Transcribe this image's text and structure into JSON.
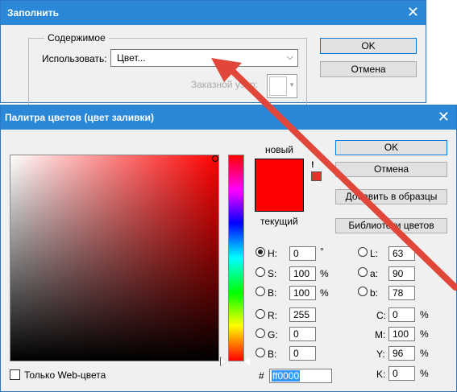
{
  "fill_dialog": {
    "title": "Заполнить",
    "close_icon": "close-icon",
    "group_label": "Содержимое",
    "use_label": "Использовать:",
    "use_value": "Цвет...",
    "custom_label": "Заказной узор:",
    "ok_label": "OK",
    "cancel_label": "Отмена"
  },
  "picker": {
    "title": "Палитра цветов (цвет заливки)",
    "close_icon": "close-icon",
    "new_label": "новый",
    "current_label": "текущий",
    "new_color": "#ff0000",
    "current_color": "#ff0000",
    "buttons": {
      "ok": "OK",
      "cancel": "Отмена",
      "add_to_swatches": "Добавить в образцы",
      "color_libraries": "Библиотеки цветов"
    },
    "hsb": {
      "h_label": "H:",
      "h_value": "0",
      "h_unit": "°",
      "s_label": "S:",
      "s_value": "100",
      "s_unit": "%",
      "b_label": "B:",
      "b_value": "100",
      "b_unit": "%"
    },
    "rgb": {
      "r_label": "R:",
      "r_value": "255",
      "g_label": "G:",
      "g_value": "0",
      "b_label": "B:",
      "b_value": "0"
    },
    "lab": {
      "l_label": "L:",
      "l_value": "63",
      "a_label": "a:",
      "a_value": "90",
      "b_label": "b:",
      "b_value": "78"
    },
    "cmyk": {
      "c_label": "C:",
      "c_value": "0",
      "c_unit": "%",
      "m_label": "M:",
      "m_value": "100",
      "m_unit": "%",
      "y_label": "Y:",
      "y_value": "96",
      "y_unit": "%",
      "k_label": "K:",
      "k_value": "0",
      "k_unit": "%"
    },
    "hex_hash": "#",
    "hex_value": "ff0000",
    "web_only_label": "Только Web-цвета",
    "warning_icon": "!"
  },
  "annotation": {
    "arrow_color": "#e0463a"
  }
}
